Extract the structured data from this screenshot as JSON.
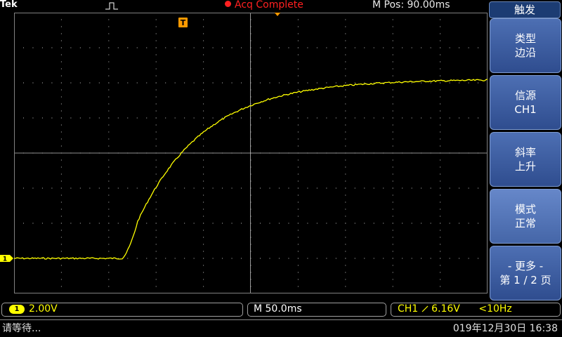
{
  "header": {
    "brand": "Tek",
    "acq_status": "Acq Complete",
    "mpos": "M Pos: 90.00ms"
  },
  "side_menu": {
    "title": "触发",
    "buttons": [
      {
        "line1": "类型",
        "line2": "边沿"
      },
      {
        "line1": "信源",
        "line2": "CH1"
      },
      {
        "line1": "斜率",
        "line2": "上升"
      },
      {
        "line1": "模式",
        "line2": "正常"
      },
      {
        "line1": "- 更多 -",
        "line2": "第 1 / 2 页"
      }
    ]
  },
  "readouts": {
    "ch1_badge": "1",
    "ch1_scale": "2.00V",
    "timebase": "M 50.0ms",
    "trigger_source": "CH1",
    "trigger_level": "6.16V",
    "trigger_freq": "<10Hz"
  },
  "status_bar": {
    "message": "请等待...",
    "datetime": "019年12月30日 16:38"
  },
  "markers": {
    "trigger_pos_label": "T",
    "ch1_marker_label": "1"
  },
  "colors": {
    "trace": "#ffff00",
    "grid": "#bfbfbf",
    "menu_blue": "#3a5ba0",
    "acq_red": "#ff2020",
    "trigger_orange": "#ff9a00"
  }
}
